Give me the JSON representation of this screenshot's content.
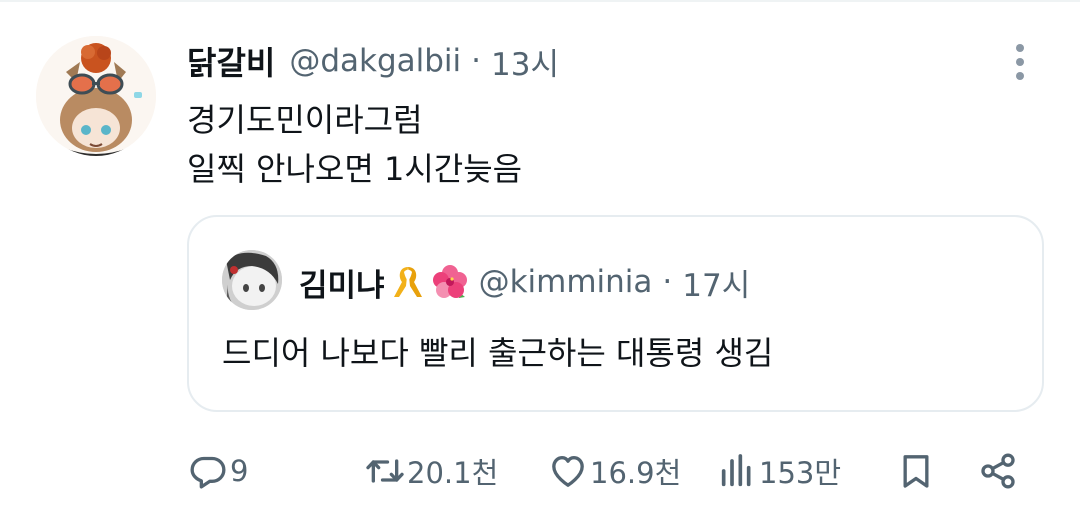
{
  "tweet": {
    "author": {
      "display_name": "닭갈비",
      "handle": "@dakgalbii"
    },
    "separator": "·",
    "time": "13시",
    "text_lines": [
      "경기도민이라그럼",
      "일찍 안나오면 1시간늦음"
    ],
    "more_icon": "more-vertical-icon"
  },
  "quote": {
    "author": {
      "display_name": "김미냐",
      "handle": "@kimminia"
    },
    "badges": [
      "yellow-ribbon-emoji",
      "hibiscus-emoji"
    ],
    "separator": "·",
    "time": "17시",
    "text": "드디어 나보다 빨리 출근하는 대통령 생김"
  },
  "actions": {
    "reply": {
      "icon": "reply-icon",
      "count": "9"
    },
    "retweet": {
      "icon": "retweet-icon",
      "count": "20.1천"
    },
    "like": {
      "icon": "heart-icon",
      "count": "16.9천"
    },
    "views": {
      "icon": "views-chart-icon",
      "count": "153만"
    },
    "bookmark": {
      "icon": "bookmark-icon"
    },
    "share": {
      "icon": "share-icon"
    }
  },
  "colors": {
    "text_primary": "#0f1419",
    "text_secondary": "#536471",
    "border": "#e6ecf0",
    "background": "#ffffff"
  }
}
